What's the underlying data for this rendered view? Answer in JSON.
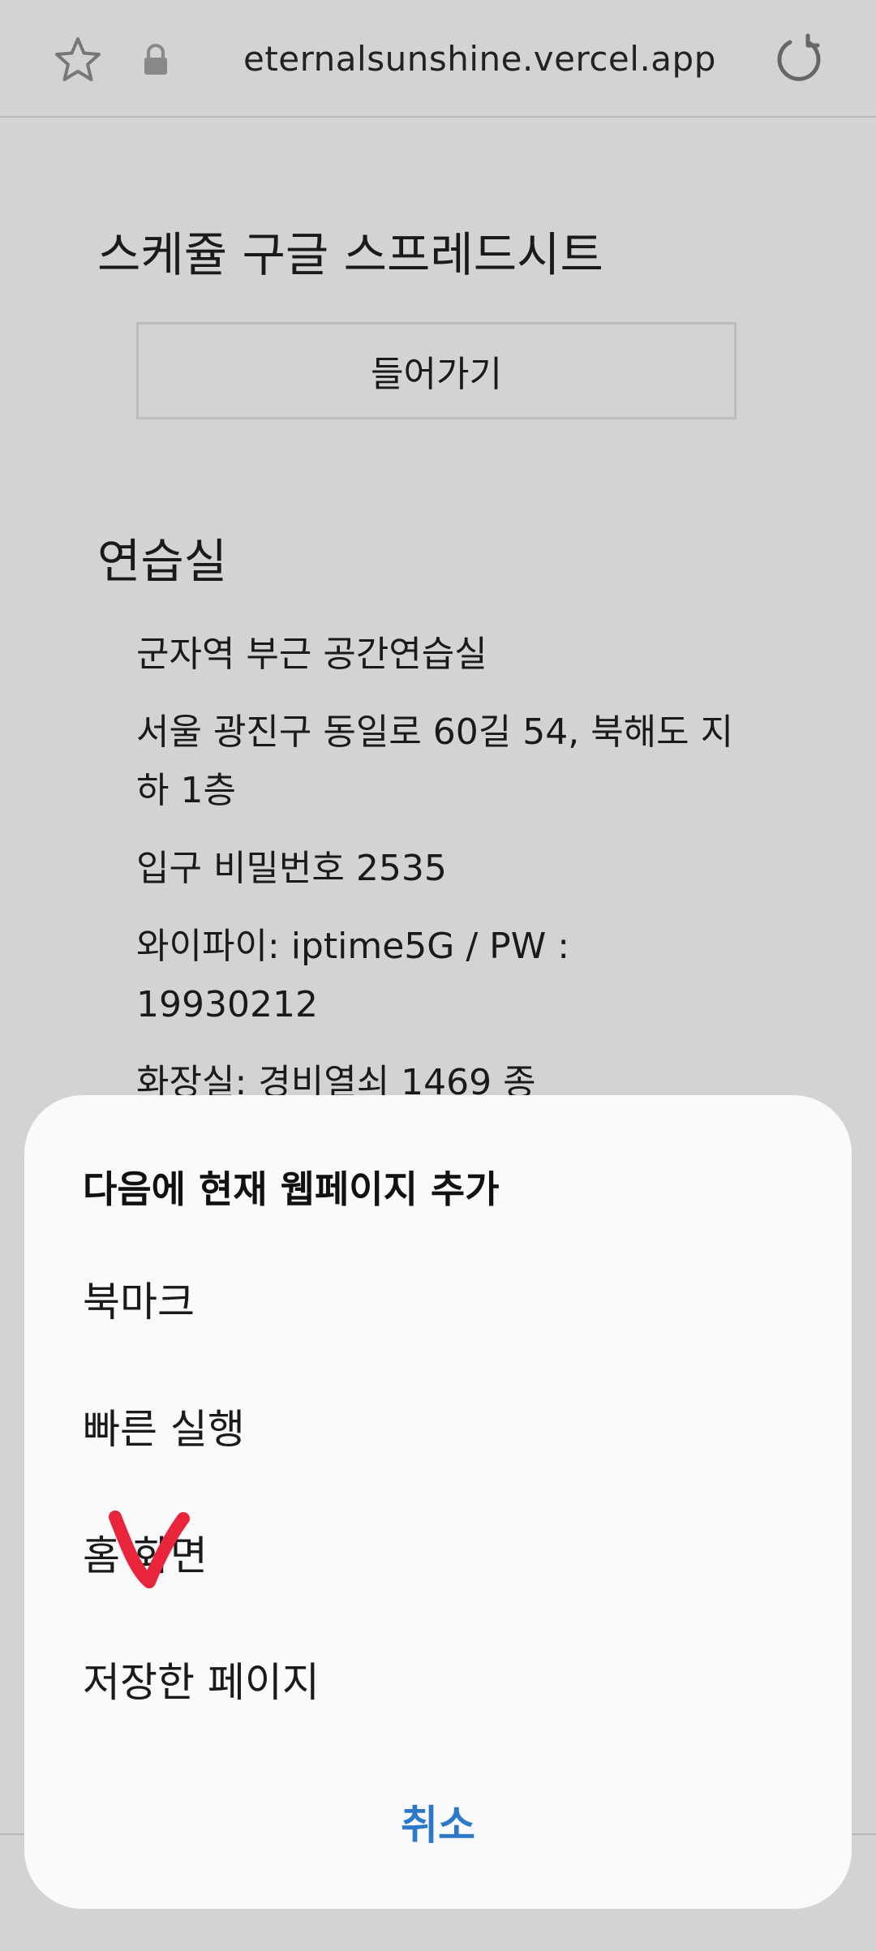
{
  "address_bar": {
    "url": "eternalsunshine.vercel.app",
    "bookmark_icon": "star-icon",
    "secure_icon": "lock-icon",
    "reload_icon": "reload-icon"
  },
  "page": {
    "schedule_title": "스케쥴 구글 스프레드시트",
    "enter_button": "들어가기",
    "studio_title": "연습실",
    "info_lines": [
      "군자역 부근 공간연습실",
      "서울 광진구 동일로 60길 54, 북해도 지하 1층",
      "입구 비밀번호 2535",
      "와이파이: iptime5G / PW : 19930212",
      "화장실: 경비열쇠 1469 종"
    ]
  },
  "sheet": {
    "title": "다음에 현재 웹페이지 추가",
    "items": [
      "북마크",
      "빠른 실행",
      "홈 화면",
      "저장한 페이지"
    ],
    "cancel": "취소"
  },
  "colors": {
    "background": "#d3d3d3",
    "sheet_bg": "#fafafd",
    "accent": "#2e78c8",
    "annotation": "#e8253a"
  }
}
